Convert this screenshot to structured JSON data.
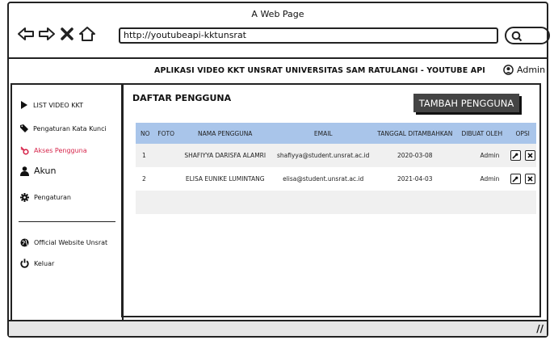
{
  "window": {
    "title": "A Web Page"
  },
  "browser": {
    "url": "http://youtubeapi-kktunsrat"
  },
  "header": {
    "app_title": "APLIKASI VIDEO KKT UNSRAT UNIVERSITAS SAM RATULANGI - YOUTUBE API",
    "user": "Admin"
  },
  "sidebar": {
    "items": [
      {
        "label": "LIST VIDEO KKT",
        "icon": "play-icon"
      },
      {
        "label": "Pengaturan Kata Kunci",
        "icon": "tag-icon"
      },
      {
        "label": "Akses Pengguna",
        "icon": "key-icon",
        "active": true
      },
      {
        "label": "Akun",
        "icon": "user-icon"
      },
      {
        "label": "Pengaturan",
        "icon": "gear-icon"
      },
      {
        "label": "Official Website Unsrat",
        "icon": "globe-icon"
      },
      {
        "label": "Keluar",
        "icon": "power-icon"
      }
    ]
  },
  "main": {
    "title": "DAFTAR PENGGUNA",
    "add_button": "TAMBAH PENGGUNA",
    "table": {
      "headers": [
        "NO",
        "FOTO",
        "NAMA PENGGUNA",
        "EMAIL",
        "TANGGAL DITAMBAHKAN",
        "DIBUAT OLEH",
        "OPSI"
      ],
      "rows": [
        {
          "no": "1",
          "nama": "SHAFIYYA DARISFA ALAMRI",
          "email": "shafiyya@student.unsrat.ac.id",
          "tanggal": "2020-03-08",
          "oleh": "Admin"
        },
        {
          "no": "2",
          "nama": "ELISA EUNIKE LUMINTANG",
          "email": "elisa@student.unsrat.ac.id",
          "tanggal": "2021-04-03",
          "oleh": "Admin"
        }
      ]
    }
  },
  "colors": {
    "table_header": "#a9c5ea",
    "active_item": "#d6244a",
    "button_bg": "#444444"
  }
}
